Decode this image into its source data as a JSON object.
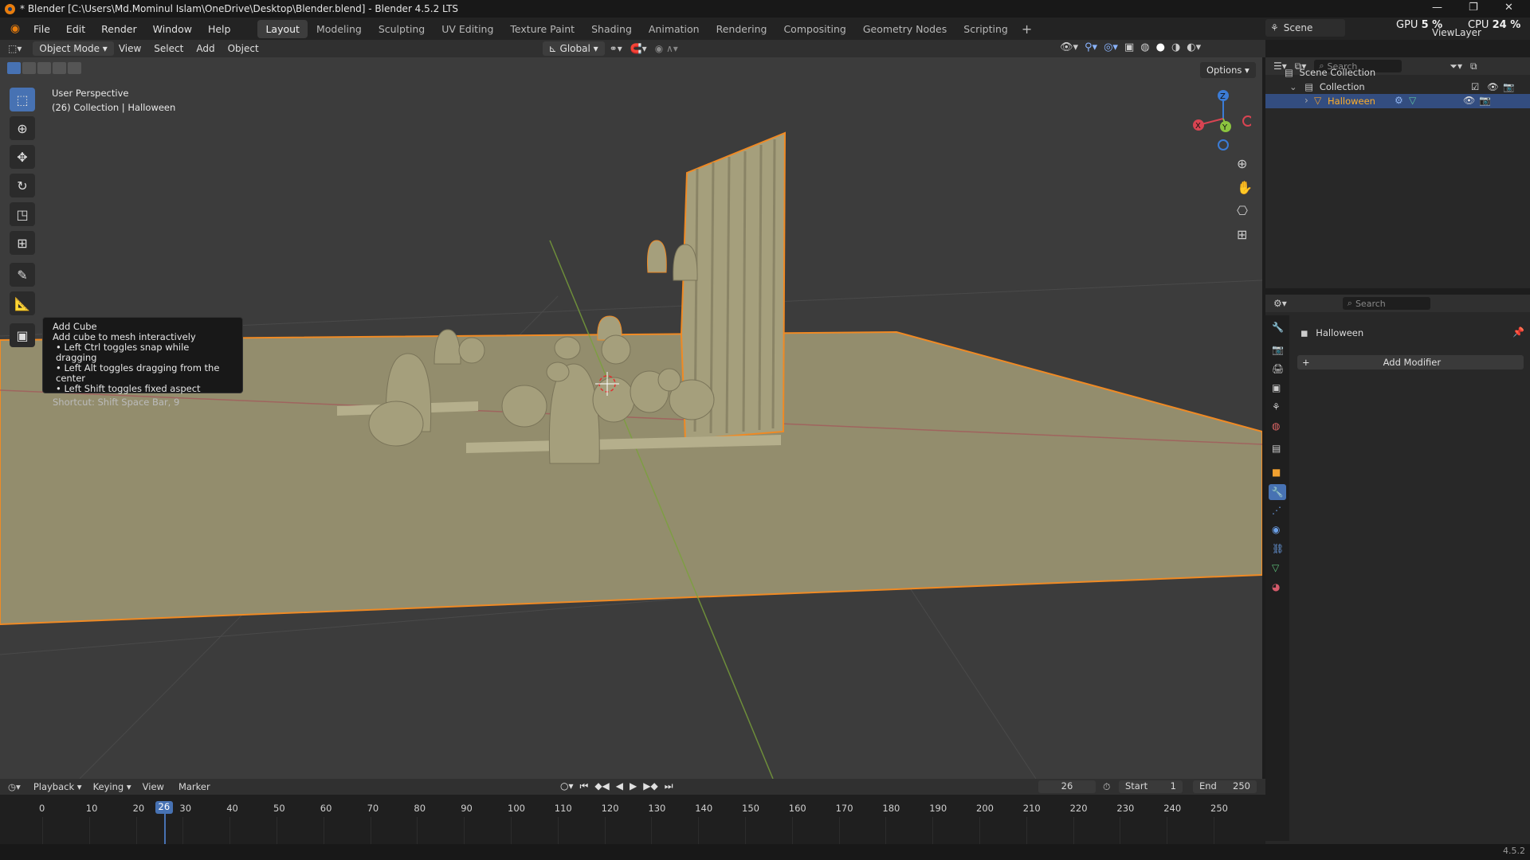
{
  "window": {
    "title": "* Blender [C:\\Users\\Md.Mominul Islam\\OneDrive\\Desktop\\Blender.blend] - Blender 4.5.2 LTS",
    "controls": [
      "minimize",
      "maximize",
      "close"
    ]
  },
  "menubar": {
    "items": [
      "File",
      "Edit",
      "Render",
      "Window",
      "Help"
    ],
    "workspaces": [
      "Layout",
      "Modeling",
      "Sculpting",
      "UV Editing",
      "Texture Paint",
      "Shading",
      "Animation",
      "Rendering",
      "Compositing",
      "Geometry Nodes",
      "Scripting"
    ],
    "active_workspace": "Layout",
    "scene": "Scene",
    "view_layer": "ViewLayer",
    "gpu_label": "GPU",
    "gpu_value": "5 %",
    "cpu_label": "CPU",
    "cpu_value": "24 %"
  },
  "viewport_header": {
    "mode": "Object Mode",
    "menus": [
      "View",
      "Select",
      "Add",
      "Object"
    ],
    "transform_orientation": "Global",
    "options_label": "Options"
  },
  "viewport": {
    "perspective_label": "User Perspective",
    "collection_label": "(26) Collection | Halloween",
    "gizmo_axes": [
      "X",
      "Y",
      "Z"
    ],
    "colors": {
      "selection_outline": "#f08a24",
      "model": "#a59f7c",
      "background": "#3c3c3c",
      "x_axis": "#d94452",
      "y_axis": "#8bc43f",
      "z_axis": "#3b7cd6"
    }
  },
  "tooltip": {
    "title": "Add Cube",
    "description": "Add cube to mesh interactively",
    "bullets": [
      "• Left Ctrl toggles snap while dragging",
      "• Left Alt toggles dragging from the center",
      "• Left Shift toggles fixed aspect"
    ],
    "shortcut": "Shortcut: Shift Space Bar, 9"
  },
  "tools": [
    "select-box-icon",
    "cursor-icon",
    "move-icon",
    "rotate-icon",
    "scale-icon",
    "transform-icon",
    "annotate-icon",
    "measure-icon",
    "add-cube-icon"
  ],
  "outliner": {
    "search_placeholder": "Search",
    "scene_collection": "Scene Collection",
    "collection": "Collection",
    "object": "Halloween"
  },
  "properties": {
    "search_placeholder": "Search",
    "object_name": "Halloween",
    "add_modifier": "Add Modifier"
  },
  "timeline": {
    "menus": [
      "Playback",
      "Keying",
      "View",
      "Marker"
    ],
    "current_frame": "26",
    "start_label": "Start",
    "start_value": "1",
    "end_label": "End",
    "end_value": "250",
    "ticks": [
      "0",
      "10",
      "20",
      "30",
      "40",
      "50",
      "60",
      "70",
      "80",
      "90",
      "100",
      "110",
      "120",
      "130",
      "140",
      "150",
      "160",
      "170",
      "180",
      "190",
      "200",
      "210",
      "220",
      "230",
      "240",
      "250"
    ],
    "playhead_frame": 26
  },
  "statusbar": {
    "version": "4.5.2"
  }
}
